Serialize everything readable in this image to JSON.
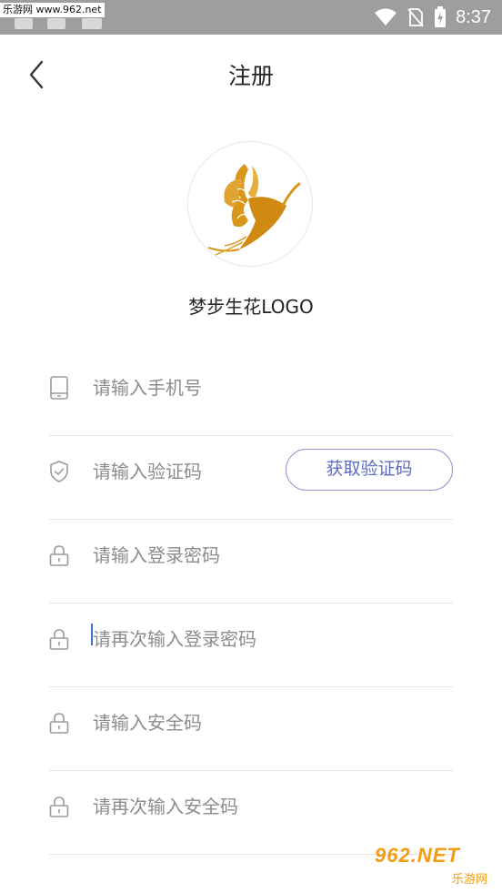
{
  "status_bar": {
    "watermark": "乐游网 www.962.net",
    "time": "8:37",
    "icons": [
      "wifi-icon",
      "no-sim-icon",
      "battery-charging-icon"
    ]
  },
  "header": {
    "title": "注册",
    "back_icon": "chevron-left-icon"
  },
  "logo": {
    "caption": "梦步生花LOGO",
    "accent_color": "#d9961a"
  },
  "form": {
    "phone": {
      "placeholder": "请输入手机号",
      "icon": "phone-icon"
    },
    "code": {
      "placeholder": "请输入验证码",
      "icon": "shield-check-icon",
      "button_label": "获取验证码"
    },
    "password": {
      "placeholder": "请输入登录密码",
      "icon": "lock-icon"
    },
    "password_confirm": {
      "placeholder": "请再次输入登录密码",
      "icon": "lock-icon"
    },
    "safe_code": {
      "placeholder": "请输入安全码",
      "icon": "lock-icon"
    },
    "safe_code_confirm": {
      "placeholder": "请再次输入安全码",
      "icon": "lock-icon"
    }
  },
  "watermark": {
    "brand": "962.NET",
    "sub": "乐游网"
  },
  "colors": {
    "button_border": "#8e96c8",
    "button_text": "#5c6bc0",
    "placeholder": "#8c8c8c",
    "divider": "#e5e5e5"
  }
}
